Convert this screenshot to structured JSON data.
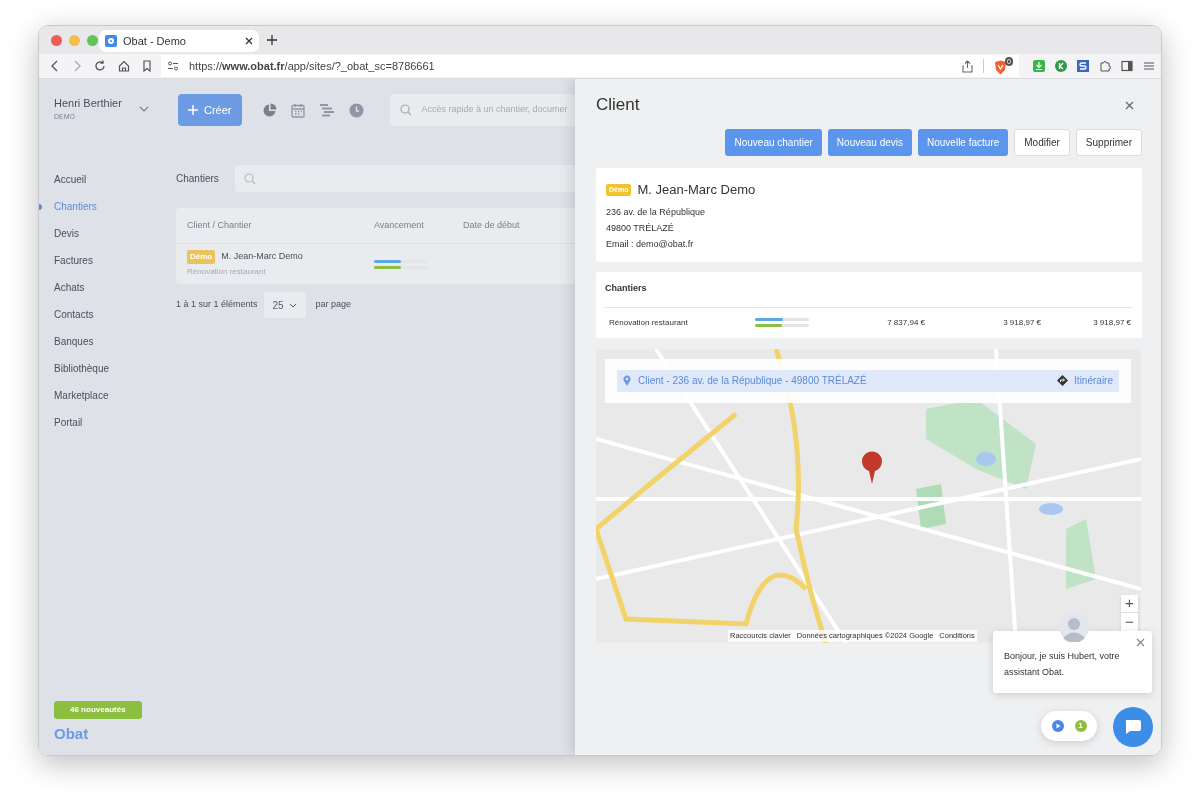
{
  "browser": {
    "tab_title": "Obat - Demo",
    "url": "https://**www.obat.fr**/app/sites/?_obat_sc=8786661",
    "brave_badge": "0"
  },
  "sidebar": {
    "user_name": "Henri Berthier",
    "user_org": "DEMO",
    "items": [
      {
        "label": "Accueil",
        "selected": false
      },
      {
        "label": "Chantiers",
        "selected": true
      },
      {
        "label": "Devis",
        "selected": false
      },
      {
        "label": "Factures",
        "selected": false
      },
      {
        "label": "Achats",
        "selected": false
      },
      {
        "label": "Contacts",
        "selected": false
      },
      {
        "label": "Banques",
        "selected": false
      },
      {
        "label": "Bibliothèque",
        "selected": false
      },
      {
        "label": "Marketplace",
        "selected": false
      },
      {
        "label": "Portail",
        "selected": false
      }
    ],
    "news_badge": "46 nouveautés",
    "logo": "Obat"
  },
  "topbar": {
    "create_button": "Créer",
    "search_placeholder": "Accès rapide à un chantier, documer"
  },
  "list": {
    "title": "Chantiers",
    "columns": [
      "Client / Chantier",
      "Avancement",
      "Date de début"
    ],
    "rows": [
      {
        "badge": "Démo",
        "client": "M. Jean-Marc Demo",
        "chantier": "Rénovation restaurant",
        "progress": [
          {
            "level": 0.5
          },
          {
            "level": 0.5
          }
        ]
      }
    ],
    "pagination": {
      "summary": "1 à 1 sur 1 éléments",
      "per_page": "25",
      "suffix": "par page"
    }
  },
  "panel": {
    "title": "Client",
    "buttons": [
      {
        "label": "Nouveau chantier",
        "kind": "primary"
      },
      {
        "label": "Nouveau devis",
        "kind": "primary"
      },
      {
        "label": "Nouvelle facture",
        "kind": "primary"
      },
      {
        "label": "Modifier",
        "kind": "secondary"
      },
      {
        "label": "Supprimer",
        "kind": "secondary"
      }
    ],
    "client": {
      "badge": "Démo",
      "name": "M. Jean-Marc Demo",
      "lines": [
        "236 av. de la République",
        "49800 TRÉLAZÉ",
        "Email : demo@obat.fr"
      ]
    },
    "chantiers": {
      "title": "Chantiers",
      "rows": [
        {
          "name": "Rénovation restaurant",
          "progress": [
            {
              "level": 0.52
            },
            {
              "level": 0.5
            }
          ],
          "amounts": [
            "7 837,94 €",
            "3 918,97 €",
            "3 918,97 €"
          ]
        }
      ]
    },
    "map": {
      "address": "Client - 236 av. de la République - 49800 TRÉLAZÉ",
      "directions": "Itinéraire",
      "zoom_in": "+",
      "zoom_out": "−",
      "footer": [
        "Raccourcis clavier",
        "Données cartographiques ©2024 Google",
        "Conditions"
      ]
    },
    "chat": {
      "message": "Bonjour, je suis Hubert, votre assistant Obat.",
      "count": "1"
    }
  }
}
